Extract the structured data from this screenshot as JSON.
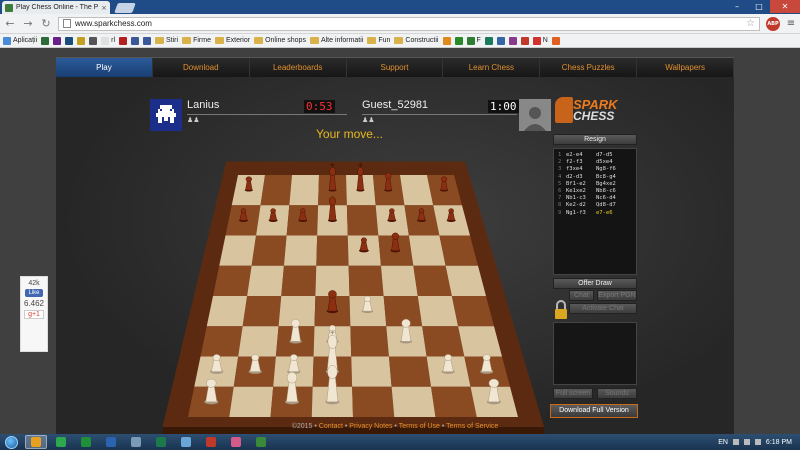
{
  "browser": {
    "tab_title": "Play Chess Online - The P",
    "tab_close": "×",
    "url": "www.sparkchess.com",
    "abp_label": "ABP",
    "window_controls": {
      "minimize": "–",
      "maximize": "□",
      "close": "✕"
    }
  },
  "bookmarks": [
    {
      "label": "Aplicații",
      "icon_color": "#4a8bd8",
      "folder": false
    },
    {
      "label": "",
      "icon_color": "#2d6b3a",
      "folder": false
    },
    {
      "label": "",
      "icon_color": "#6a1f8a",
      "folder": false
    },
    {
      "label": "",
      "icon_color": "#1b4d7a",
      "folder": false
    },
    {
      "label": "",
      "icon_color": "#c4a020",
      "folder": false
    },
    {
      "label": "",
      "icon_color": "#555555",
      "folder": false
    },
    {
      "label": "rl",
      "icon_color": "#e0e0e0",
      "folder": false
    },
    {
      "label": "",
      "icon_color": "#b32020",
      "folder": false
    },
    {
      "label": "",
      "icon_color": "#3b5998",
      "folder": false
    },
    {
      "label": "",
      "icon_color": "#3b5998",
      "folder": false
    },
    {
      "label": "Stiri",
      "icon_color": "#d9b34a",
      "folder": true
    },
    {
      "label": "Firme",
      "icon_color": "#d9b34a",
      "folder": true
    },
    {
      "label": "Exterior",
      "icon_color": "#d9b34a",
      "folder": true
    },
    {
      "label": "Online shops",
      "icon_color": "#d9b34a",
      "folder": true
    },
    {
      "label": "Alte informatii",
      "icon_color": "#d9b34a",
      "folder": true
    },
    {
      "label": "Fun",
      "icon_color": "#d9b34a",
      "folder": true
    },
    {
      "label": "Constructii",
      "icon_color": "#d9b34a",
      "folder": true
    },
    {
      "label": "",
      "icon_color": "#e08a1c",
      "folder": false
    },
    {
      "label": "",
      "icon_color": "#2a8a2a",
      "folder": false
    },
    {
      "label": "F",
      "icon_color": "#2e7d32",
      "folder": false
    },
    {
      "label": "",
      "icon_color": "#1a7a5a",
      "folder": false
    },
    {
      "label": "",
      "icon_color": "#3465a4",
      "folder": false
    },
    {
      "label": "",
      "icon_color": "#8a3a8a",
      "folder": false
    },
    {
      "label": "",
      "icon_color": "#c0392b",
      "folder": false
    },
    {
      "label": "N",
      "icon_color": "#d43030",
      "folder": false
    },
    {
      "label": "",
      "icon_color": "#e06020",
      "folder": false
    }
  ],
  "nav": [
    "Play",
    "Download",
    "Leaderboards",
    "Support",
    "Learn Chess",
    "Chess Puzzles",
    "Wallpapers"
  ],
  "player1": {
    "name": "Lanius",
    "clock": "0:53",
    "pawns": "♟♟"
  },
  "player2": {
    "name": "Guest_52981",
    "clock": "1:00",
    "pawns": "♟♟"
  },
  "status": "Your move...",
  "logo": {
    "line1": "SPARK",
    "line2": "CHESS"
  },
  "panel": {
    "resign": "Resign",
    "offer_draw": "Offer Draw",
    "chat": "Chat",
    "export_pgn": "Export PGN",
    "activate_chat": "Activate Chat",
    "full_screen": "Full screen",
    "sounds": "Sounds",
    "download_full": "Download Full Version"
  },
  "moves": [
    {
      "n": "1",
      "w": "e2-e4",
      "b": "d7-d5"
    },
    {
      "n": "2",
      "w": "f2-f3",
      "b": "d5xe4"
    },
    {
      "n": "3",
      "w": "f3xe4",
      "b": "Ng8-f6"
    },
    {
      "n": "4",
      "w": "d2-d3",
      "b": "Bc8-g4"
    },
    {
      "n": "5",
      "w": "Bf1-e2",
      "b": "Bg4xe2"
    },
    {
      "n": "6",
      "w": "Ke1xe2",
      "b": "Nb8-c6"
    },
    {
      "n": "7",
      "w": "Nb1-c3",
      "b": "Nc6-d4"
    },
    {
      "n": "8",
      "w": "Ke2-d2",
      "b": "Qd8-d7"
    },
    {
      "n": "9",
      "w": "Ng1-f3",
      "b": "e7-e6"
    }
  ],
  "social": {
    "likes": "42k",
    "like_label": "Like",
    "count": "6.462",
    "gplus": "g+1"
  },
  "footer": {
    "copyright": "©2015 •",
    "links": [
      "Contact",
      "Privacy Notes",
      "Terms of Use",
      "Terms of Service"
    ],
    "sep": "•"
  },
  "taskbar": {
    "lang": "EN",
    "time": "6:18 PM",
    "apps": [
      {
        "color": "#e8a020",
        "active": true
      },
      {
        "color": "#2da84e",
        "active": false
      },
      {
        "color": "#1f8f3a",
        "active": false
      },
      {
        "color": "#2b63b0",
        "active": false
      },
      {
        "color": "#7a9ab8",
        "active": false
      },
      {
        "color": "#1c7a4a",
        "active": false
      },
      {
        "color": "#6aa5d8",
        "active": false
      },
      {
        "color": "#c0392b",
        "active": false
      },
      {
        "color": "#d45a8a",
        "active": false
      },
      {
        "color": "#3a8a3a",
        "active": false
      }
    ]
  },
  "board": {
    "pieces": [
      {
        "sq": "a8",
        "t": "R",
        "c": "b"
      },
      {
        "sq": "d8",
        "t": "K",
        "c": "b"
      },
      {
        "sq": "e8",
        "t": "K",
        "c": "b"
      },
      {
        "sq": "f8",
        "t": "B",
        "c": "b"
      },
      {
        "sq": "h8",
        "t": "R",
        "c": "b"
      },
      {
        "sq": "a7",
        "t": "P",
        "c": "b"
      },
      {
        "sq": "b7",
        "t": "P",
        "c": "b"
      },
      {
        "sq": "c7",
        "t": "P",
        "c": "b"
      },
      {
        "sq": "d7",
        "t": "Q",
        "c": "b"
      },
      {
        "sq": "f7",
        "t": "P",
        "c": "b"
      },
      {
        "sq": "g7",
        "t": "P",
        "c": "b"
      },
      {
        "sq": "h7",
        "t": "P",
        "c": "b"
      },
      {
        "sq": "e6",
        "t": "P",
        "c": "b"
      },
      {
        "sq": "f6",
        "t": "N",
        "c": "b"
      },
      {
        "sq": "d4",
        "t": "N",
        "c": "b"
      },
      {
        "sq": "c3",
        "t": "N",
        "c": "w"
      },
      {
        "sq": "d3",
        "t": "P",
        "c": "w"
      },
      {
        "sq": "e4",
        "t": "P",
        "c": "w"
      },
      {
        "sq": "f3",
        "t": "N",
        "c": "w"
      },
      {
        "sq": "a2",
        "t": "P",
        "c": "w"
      },
      {
        "sq": "b2",
        "t": "P",
        "c": "w"
      },
      {
        "sq": "c2",
        "t": "P",
        "c": "w"
      },
      {
        "sq": "d2",
        "t": "K",
        "c": "w"
      },
      {
        "sq": "g2",
        "t": "P",
        "c": "w"
      },
      {
        "sq": "h2",
        "t": "P",
        "c": "w"
      },
      {
        "sq": "a1",
        "t": "R",
        "c": "w"
      },
      {
        "sq": "c1",
        "t": "B",
        "c": "w"
      },
      {
        "sq": "d1",
        "t": "Q",
        "c": "w"
      },
      {
        "sq": "h1",
        "t": "R",
        "c": "w"
      }
    ]
  },
  "colors": {
    "accent": "#e3902c",
    "nav_active": "#2b5b9a",
    "clock_red": "#ff3030",
    "status_yellow": "#e8b820",
    "light_square": "#d9c4a0",
    "dark_square": "#8a4a22"
  }
}
